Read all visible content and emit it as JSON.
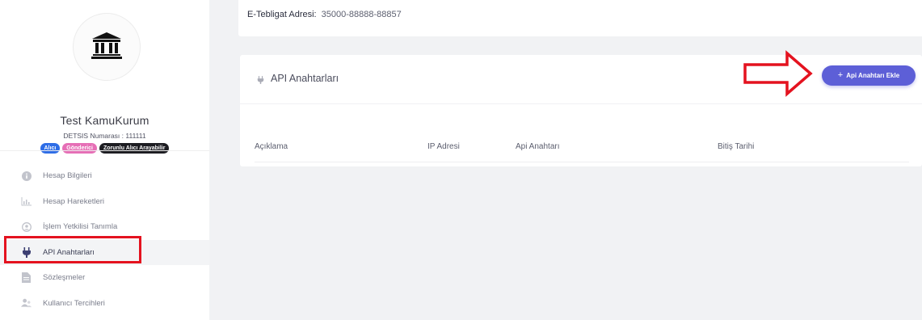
{
  "profile": {
    "org_name": "Test KamuKurum",
    "detsis": "DETSIS Numarası : 111111",
    "badges": [
      "Alıcı",
      "Gönderici",
      "Zorunlu Alıcı Arayabilir"
    ]
  },
  "sidebar": {
    "items": [
      {
        "label": "Hesap Bilgileri",
        "icon": "info-icon"
      },
      {
        "label": "Hesap Hareketleri",
        "icon": "chart-icon"
      },
      {
        "label": "İşlem Yetkilisi Tanımla",
        "icon": "user-circle-icon"
      },
      {
        "label": "API Anahtarları",
        "icon": "plug-icon",
        "active": true
      },
      {
        "label": "Sözleşmeler",
        "icon": "document-icon"
      },
      {
        "label": "Kullanıcı Tercihleri",
        "icon": "users-icon"
      }
    ]
  },
  "top": {
    "etebligat_label": "E-Tebligat Adresi:",
    "etebligat_value": "35000-88888-88857"
  },
  "api_card": {
    "title": "API Anahtarları",
    "add_button": "Api Anahtarı Ekle",
    "columns": [
      "Açıklama",
      "IP Adresi",
      "Api Anahtarı",
      "Bitiş Tarihi"
    ]
  },
  "colors": {
    "accent": "#5d5fd7",
    "annotation": "#e4121f",
    "active_icon": "#3c3f72"
  }
}
